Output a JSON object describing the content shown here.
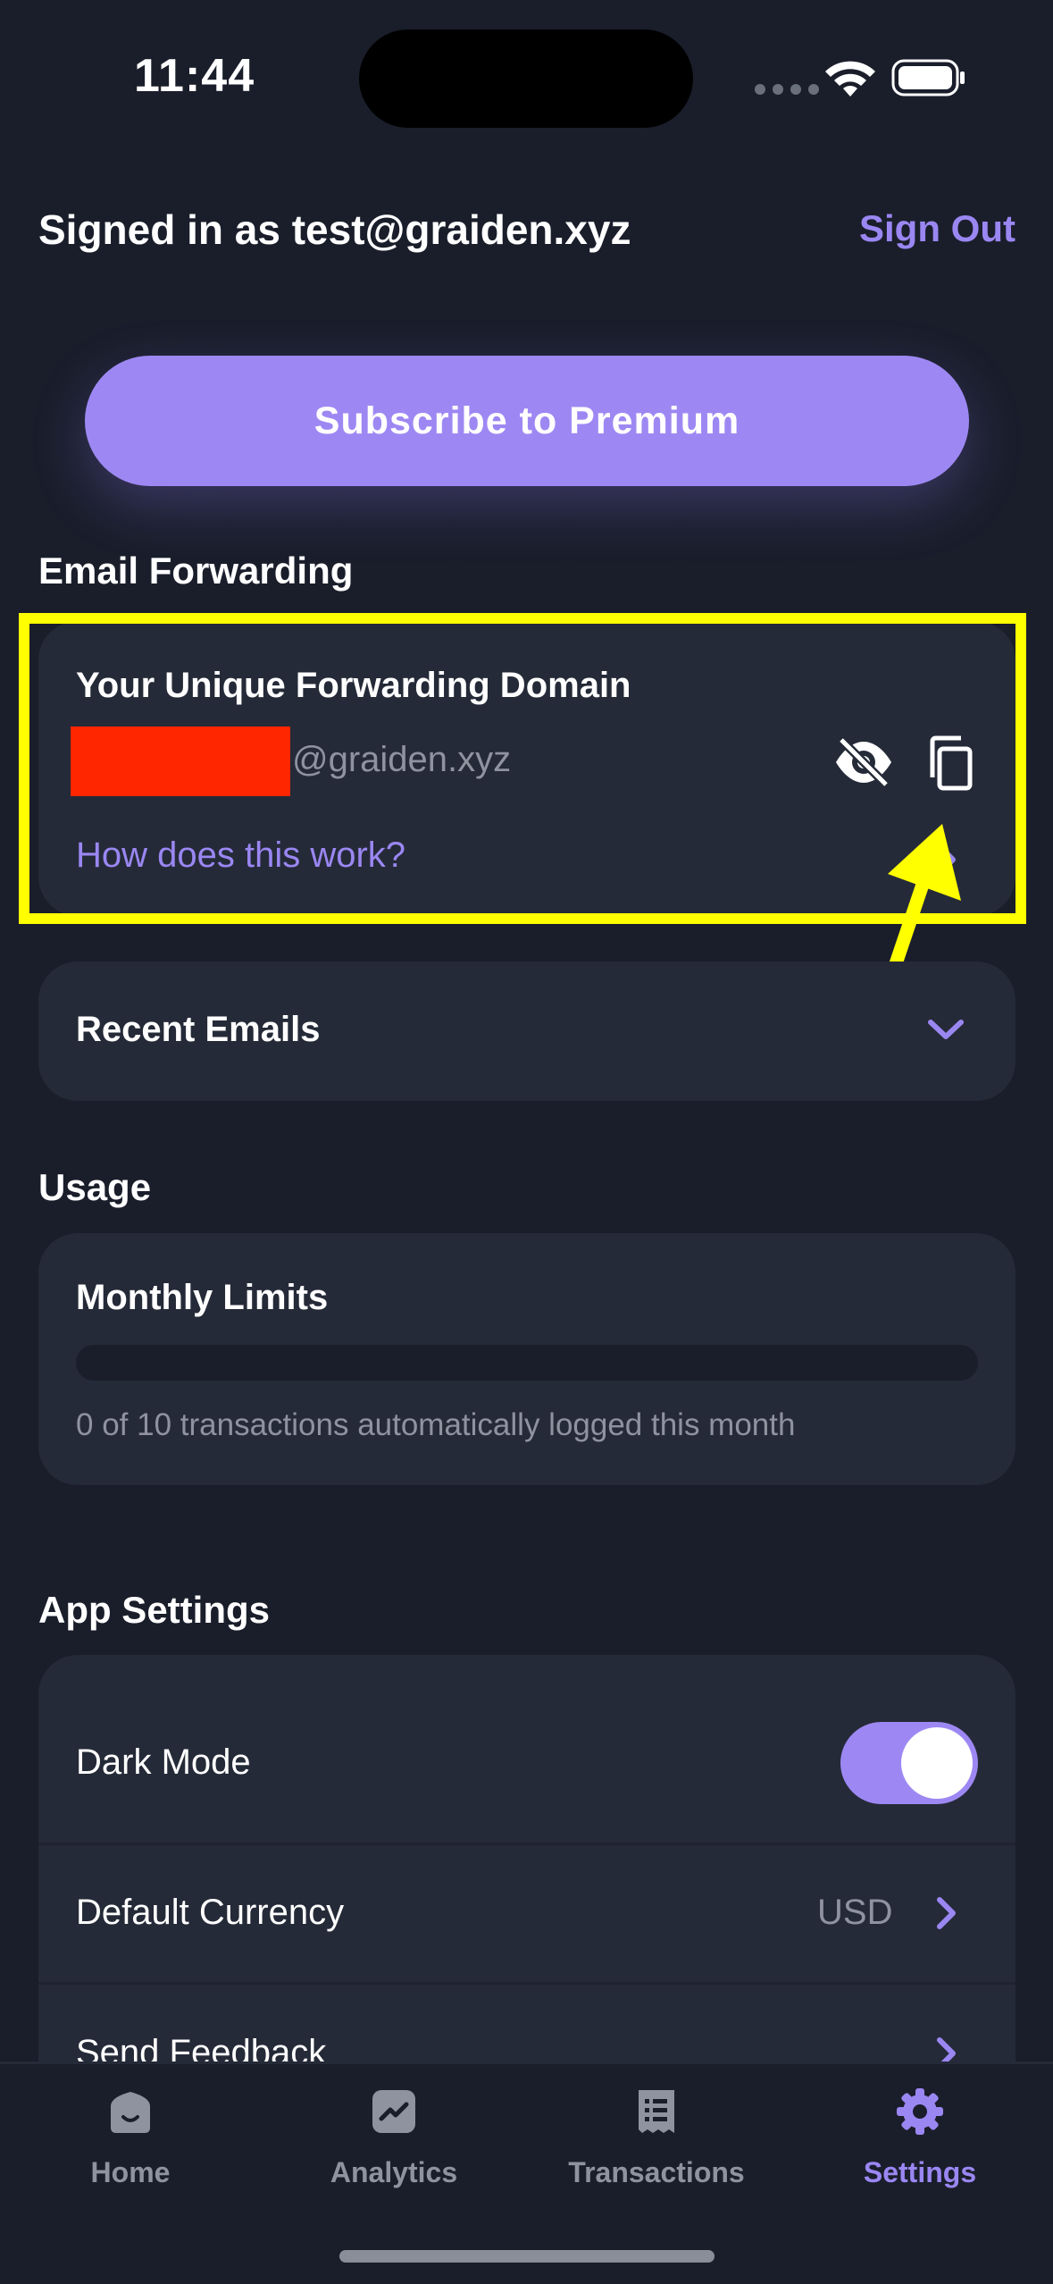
{
  "status_bar": {
    "time": "11:44"
  },
  "header": {
    "signed_in": "Signed in as test@graiden.xyz",
    "sign_out": "Sign Out"
  },
  "subscribe": {
    "label": "Subscribe to Premium"
  },
  "email_forwarding": {
    "section_title": "Email Forwarding",
    "card_title": "Your Unique Forwarding Domain",
    "domain_suffix": "@graiden.xyz",
    "how_link": "How does this work?"
  },
  "recent_emails": {
    "label": "Recent Emails"
  },
  "usage": {
    "section_title": "Usage",
    "card_title": "Monthly Limits",
    "progress_fraction": 0,
    "summary": "0 of 10 transactions automatically logged this month"
  },
  "app_settings": {
    "section_title": "App Settings",
    "dark_mode_label": "Dark Mode",
    "dark_mode_on": true,
    "currency_label": "Default Currency",
    "currency_value": "USD",
    "feedback_label": "Send Feedback"
  },
  "tabs": [
    {
      "label": "Home",
      "icon": "home-icon"
    },
    {
      "label": "Analytics",
      "icon": "analytics-icon"
    },
    {
      "label": "Transactions",
      "icon": "transactions-icon"
    },
    {
      "label": "Settings",
      "icon": "gear-icon",
      "active": true
    }
  ],
  "colors": {
    "background": "#1a1e2b",
    "card": "#252a38",
    "accent": "#9d88f3",
    "highlight": "#ffff00",
    "redaction": "#ff2600"
  }
}
